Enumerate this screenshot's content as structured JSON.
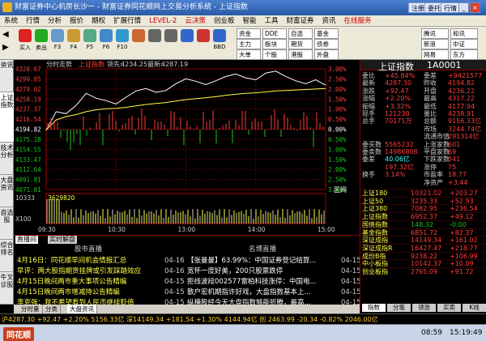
{
  "window": {
    "title": "财富证券中心机房长沙一 - 财富证券同花顺网上交易分析系统 - 上证指数",
    "buttons": [
      "注册",
      "委托",
      "行情"
    ]
  },
  "menu": [
    "系统",
    "行情",
    "分析",
    "报价",
    "期权",
    "扩展行情",
    "LEVEL-2",
    "云决策",
    "创业板",
    "智能",
    "工具",
    "财富证券",
    "资讯",
    "在线服务"
  ],
  "toolbar": {
    "tools": [
      {
        "label": "买入",
        "color": "#d22"
      },
      {
        "label": "卖出",
        "color": "#2a2"
      },
      {
        "label": "F3",
        "color": "#69c"
      },
      {
        "label": "F4",
        "color": "#c93"
      },
      {
        "label": "F5",
        "color": "#5a8"
      },
      {
        "label": "F6",
        "color": "#48c"
      },
      {
        "label": "F10",
        "color": "#39c"
      },
      {
        "label": "",
        "color": "#c63"
      },
      {
        "label": "",
        "color": "#666"
      },
      {
        "label": "",
        "color": "#666"
      },
      {
        "label": "",
        "color": "#36c"
      },
      {
        "label": "",
        "color": "#c33"
      },
      {
        "label": "BBD",
        "color": "#36c"
      }
    ],
    "right": [
      "资金",
      "主力",
      "大单",
      "DDE",
      "板块",
      "个股",
      "自选",
      "期货",
      "港股",
      "基金",
      "债券",
      "外盘"
    ],
    "right_tail": [
      "腾讯",
      "新浪",
      "网易",
      "和讯",
      "中证",
      "东方"
    ]
  },
  "left_tabs": [
    "资讯",
    "上证指数",
    "技术分析",
    "大盘资讯",
    "自选股",
    "综合排名",
    "牛叉诊股"
  ],
  "chart": {
    "header": {
      "tab": "分时走势",
      "name": "上证指数",
      "lead_label": "领先:",
      "lead": "4234.25",
      "latest_label": "最新:",
      "latest": "4287.19"
    },
    "y_left": [
      "4320.67",
      "4299.85",
      "4279.02",
      "4258.19",
      "4237.37",
      "4216.54",
      "4194.82",
      "4175.18",
      "4154.55",
      "4133.47",
      "4112.64",
      "4091.81",
      "4071.01"
    ],
    "y_right": [
      "3.00%",
      "2.50%",
      "2.00%",
      "1.50%",
      "1.00%",
      "0.50%",
      "0.00%",
      "0.50%",
      "1.00%",
      "1.50%",
      "2.00%",
      "2.50%",
      "3.00%"
    ],
    "vol_label": "3629820",
    "vol_axis": [
      "10333",
      "X100"
    ],
    "zone": "区间",
    "times": [
      "09:30",
      "10:30",
      "13:00",
      "14:00",
      "15:00"
    ]
  },
  "news": {
    "tabs": [
      "直播间",
      "实时解盘"
    ],
    "col1": "股市直播",
    "col2": "名博直播",
    "rows": [
      [
        "4月16日：同花顺早间机会情报汇总",
        "04-16",
        "【张曼曼】63.99%：中国证券登记结算...",
        "04-15"
      ],
      [
        "早评：两大股指期货挂牌或引发踩踏效应",
        "04-16",
        "宽怀一度好美，200只股票跌停",
        "04-15"
      ],
      [
        "4月15日晚间两市重大事项公告精编",
        "04-15",
        "拒线波段002577雷柏科技涨停：中国电...",
        "04-15"
      ],
      [
        "4月15日晚间两市增减持公告精编",
        "04-15",
        "散户宏机期指许好戏，大盘指数基本上...",
        "04-15"
      ],
      [
        "李克强：我不希望看到人民币继续贬值",
        "04-15",
        "纵横股经今天大盘指数够能折腾，最高...",
        "04-15"
      ]
    ]
  },
  "quote": {
    "title": "上证指数",
    "code": "1A0001",
    "rows": [
      [
        "委比",
        "+45.84%",
        "委差",
        "+9421577"
      ],
      [
        "最新",
        "4287.30",
        "昨收",
        "4194.82"
      ],
      [
        "涨跌",
        "+92.47",
        "开盘",
        "4236.22"
      ],
      [
        "涨幅",
        "+2.20%",
        "最高",
        "4317.22"
      ],
      [
        "振幅",
        "+3.32%",
        "最低",
        "4177.94"
      ],
      [
        "现手",
        "121230",
        "量比",
        "4238.91"
      ],
      [
        "总手",
        "70171万",
        "总额",
        "9156.33亿"
      ],
      [
        "",
        "",
        "市场",
        "3244.74亿"
      ],
      [
        "",
        "",
        "流通市值",
        "291314亿"
      ],
      [
        "委买数",
        "5565232",
        "上涨家数",
        "601"
      ],
      [
        "委卖数",
        "14986808",
        "平盘家数",
        "69"
      ],
      [
        "委差",
        "40.06亿",
        "下跌家数",
        "341"
      ],
      [
        "",
        "197.32亿",
        "涨停",
        "75"
      ],
      [
        "换手",
        "3.14%",
        "市盈率",
        "18.77"
      ],
      [
        "",
        "",
        "净资产",
        "+3.44"
      ]
    ],
    "indexes": [
      [
        "上证180",
        "10321.02",
        "+203.27"
      ],
      [
        "上证50",
        "3235.33",
        "+52.93"
      ],
      [
        "上证380",
        "7082.95",
        "+236.54"
      ],
      [
        "上证指数",
        "6952.37",
        "+49.12"
      ],
      [
        "国债指数",
        "148.32",
        "-0.00"
      ],
      [
        "基金指数",
        "6851.72",
        "+82.37"
      ],
      [
        "深证成指",
        "14149.34",
        "+161.02"
      ],
      [
        "深证成指R",
        "16427.47",
        "+218.77"
      ],
      [
        "成份B指",
        "9238.22",
        "+106.99"
      ],
      [
        "中小板指",
        "10142.37",
        "+10.09"
      ],
      [
        "创业板指",
        "2765.09",
        "+91.72"
      ]
    ],
    "bottom_tabs": [
      "指数",
      "分笔",
      "领涨",
      "买卖",
      "K线"
    ]
  },
  "bottom_tabs": [
    "分时量",
    "分类",
    "大盘资讯"
  ],
  "status": {
    "text": "沪4287.30 +92.47 +2.20% 5156.33亿 深14149.34 +181.54 +1.30% 4144.94亿 创 2463.99 -20.34 -0.82% 2046.00亿",
    "time": "15:19:49",
    "time2": "08:59"
  },
  "colors": {
    "up": "#ff3c3c",
    "down": "#18c818",
    "gold": "#ffff44",
    "cyan": "#40ffff"
  }
}
